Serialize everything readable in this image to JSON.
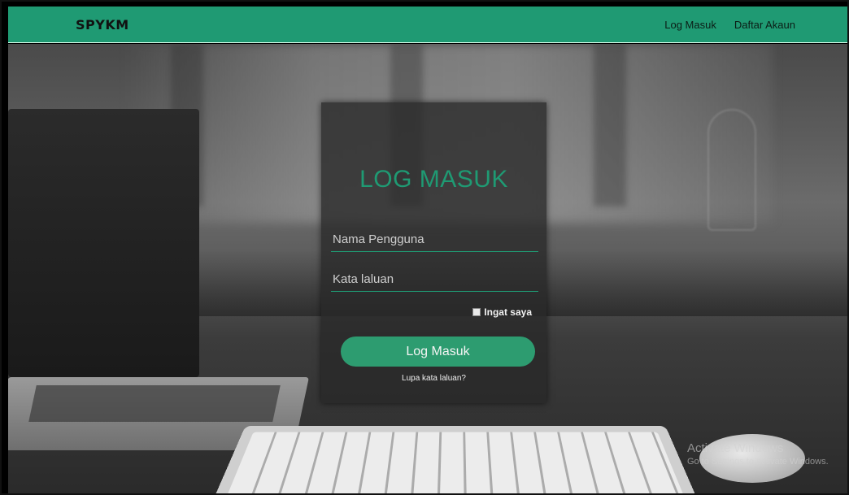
{
  "navbar": {
    "brand": "SPYKM",
    "links": [
      "Log Masuk",
      "Daftar Akaun"
    ]
  },
  "login": {
    "title": "LOG MASUK",
    "username_placeholder": "Nama Pengguna",
    "password_placeholder": "Kata laluan",
    "remember_label": "Ingat saya",
    "submit_label": "Log Masuk",
    "forgot_label": "Lupa kata laluan?"
  },
  "watermark": {
    "title": "Activate Windows",
    "subtitle": "Go to Settings to activate Windows."
  },
  "colors": {
    "accent": "#1f9a73",
    "button": "#2d9c70"
  }
}
